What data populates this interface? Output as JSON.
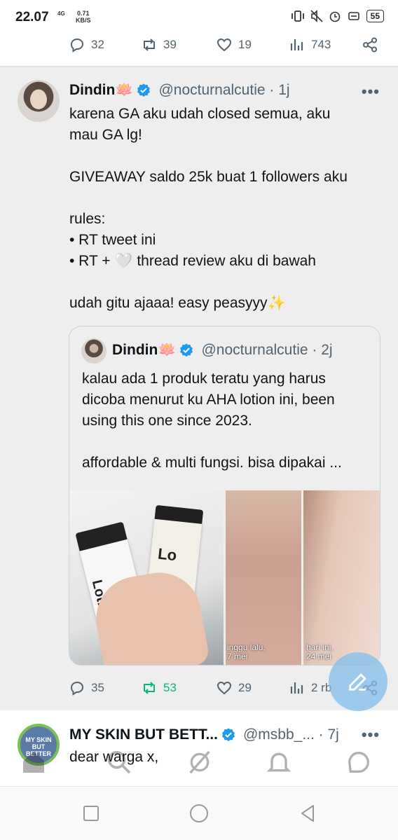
{
  "status_bar": {
    "time": "22.07",
    "network": "4G",
    "speed_value": "0.71",
    "speed_unit": "KB/S",
    "battery": "55"
  },
  "prev_tweet_actions": {
    "replies": "32",
    "retweets": "39",
    "likes": "19",
    "views": "743"
  },
  "tweet": {
    "name": "Dindin🪷",
    "handle": "@nocturnalcutie · 1j",
    "text_lines": [
      "karena GA aku udah closed semua, aku",
      "mau GA lg!",
      "",
      "GIVEAWAY saldo 25k buat 1 followers aku",
      "",
      "rules:",
      "• RT tweet ini",
      "• RT + 🤍  thread review aku di bawah",
      "",
      "udah gitu ajaaa! easy peasyyy✨"
    ],
    "actions": {
      "replies": "35",
      "retweets": "53",
      "likes": "29",
      "views": "2 rb"
    }
  },
  "quoted_tweet": {
    "name": "Dindin🪷",
    "handle": "@nocturnalcutie · 2j",
    "text_lines": [
      "kalau ada 1 produk teratu yang harus",
      "dicoba menurut ku AHA lotion ini, been",
      "using this one since 2023.",
      "",
      "affordable & multi fungsi. bisa dipakai ..."
    ],
    "media": {
      "product_label_1": "Lotion",
      "product_label_2": "Lo",
      "caption_before": "inggu lalu,\n7 mei",
      "caption_after": "hari ini,\n24 mei"
    }
  },
  "next_tweet": {
    "name": "MY SKIN BUT BETT...",
    "handle": "@msbb_... · 7j",
    "text": "dear warga x,",
    "avatar_text": "MY SKIN BUT BETTER"
  },
  "colors": {
    "accent": "#1d9bf0",
    "retweet_green": "#00ba7c",
    "muted": "#536471",
    "tweet_bg": "#eeeeee"
  }
}
